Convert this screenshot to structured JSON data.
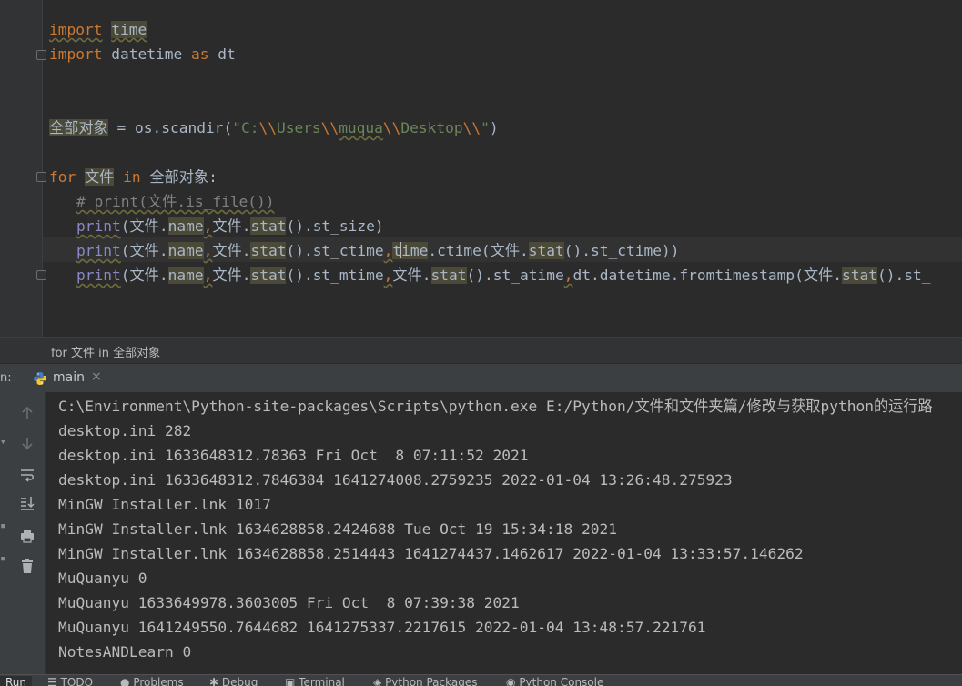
{
  "editor": {
    "line1": {
      "kw": "import",
      "mod": "time"
    },
    "line2": {
      "kw": "import",
      "mod": "datetime",
      "as": "as",
      "alias": "dt"
    },
    "line3": {
      "var": "全部对象",
      "rest1": " = os.scandir(",
      "str_open": "\"C:",
      "esc1": "\\\\",
      "str_users": "Users",
      "esc2": "\\\\",
      "str_user": "muqua",
      "esc3": "\\\\",
      "str_desk": "Desktop",
      "esc4": "\\\\",
      "str_close": "\"",
      "rest2": ")"
    },
    "line4": {
      "kw_for": "for",
      "var": "文件",
      "kw_in": "in",
      "iter": "全部对象:"
    },
    "line5": {
      "comment": "# print(文件.is_file())"
    },
    "line6": {
      "print": "print",
      "p1": "(文件.",
      "name": "name",
      "comma": ",",
      "p2": "文件.",
      "stat": "stat",
      "p3": "().st_size)"
    },
    "line7": {
      "print": "print",
      "p1": "(文件.",
      "name": "name",
      "comma": ",",
      "p2": "文件.",
      "stat": "stat",
      "p3": "().st_ctime",
      "comma2": ",",
      "t1": "t",
      "t2": "ime",
      "p4": ".ctime(文件.",
      "stat2": "stat",
      "p5": "().st_ctime))"
    },
    "line8": {
      "print": "print",
      "p1": "(文件.",
      "name": "name",
      "comma": ",",
      "p2": "文件.",
      "stat": "stat",
      "p3": "().st_mtime",
      "comma2": ",",
      "p4": "文件.",
      "stat2": "stat",
      "p5": "().st_atime",
      "comma3": ",",
      "p6": "dt.datetime.fromtimestamp(文件.",
      "stat3": "stat",
      "p7": "().st_"
    }
  },
  "breadcrumb": "for 文件 in 全部对象",
  "run_panel": {
    "label": "n:",
    "tab": "main",
    "close": "×"
  },
  "console_lines": [
    "C:\\Environment\\Python-site-packages\\Scripts\\python.exe E:/Python/文件和文件夹篇/修改与获取python的运行路",
    "desktop.ini 282",
    "desktop.ini 1633648312.78363 Fri Oct  8 07:11:52 2021",
    "desktop.ini 1633648312.7846384 1641274008.2759235 2022-01-04 13:26:48.275923",
    "MinGW Installer.lnk 1017",
    "MinGW Installer.lnk 1634628858.2424688 Tue Oct 19 15:34:18 2021",
    "MinGW Installer.lnk 1634628858.2514443 1641274437.1462617 2022-01-04 13:33:57.146262",
    "MuQuanyu 0",
    "MuQuanyu 1633649978.3603005 Fri Oct  8 07:39:38 2021",
    "MuQuanyu 1641249550.7644682 1641275337.2217615 2022-01-04 13:48:57.221761",
    "NotesANDLearn 0"
  ],
  "bottom_tabs": {
    "run": "Run",
    "todo": "TODO",
    "problems": "Problems",
    "debug": "Debug",
    "terminal": "Terminal",
    "packages": "Python Packages",
    "console": "Python Console"
  }
}
